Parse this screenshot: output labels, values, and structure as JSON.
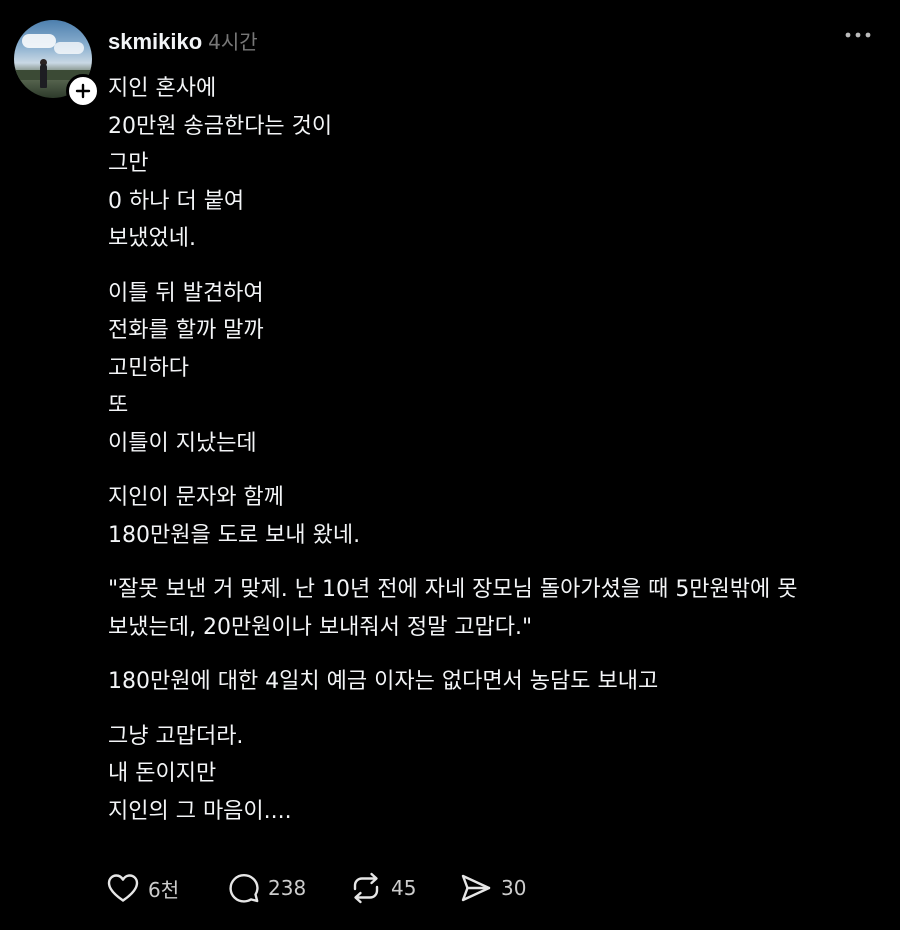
{
  "post": {
    "username": "skmikiko",
    "timestamp": "4시간",
    "paragraphs": [
      [
        "지인 혼사에",
        "20만원 송금한다는 것이",
        "그만",
        "0 하나 더 붙여",
        "보냈었네."
      ],
      [
        "이틀 뒤 발견하여",
        "전화를 할까 말까",
        "고민하다",
        "또",
        "이틀이 지났는데"
      ],
      [
        "지인이 문자와 함께",
        "180만원을 도로 보내 왔네."
      ],
      [
        "\"잘못 보낸 거 맞제. 난 10년 전에 자네 장모님 돌아가셨을 때 5만원밖에 못",
        "보냈는데, 20만원이나 보내줘서 정말 고맙다.\""
      ],
      [
        "180만원에 대한 4일치 예금 이자는 없다면서 농담도 보내고"
      ],
      [
        "그냥 고맙더라.",
        "내 돈이지만",
        "지인의 그 마음이...."
      ]
    ]
  },
  "actions": {
    "likes": "6천",
    "comments": "238",
    "reposts": "45",
    "shares": "30"
  },
  "icons": {
    "more": "more-horizontal-icon",
    "follow": "plus-icon",
    "like": "heart-icon",
    "comment": "comment-bubble-icon",
    "repost": "repost-icon",
    "share": "send-icon"
  },
  "colors": {
    "background": "#000000",
    "text": "#f3f5f7",
    "muted": "#777777"
  }
}
